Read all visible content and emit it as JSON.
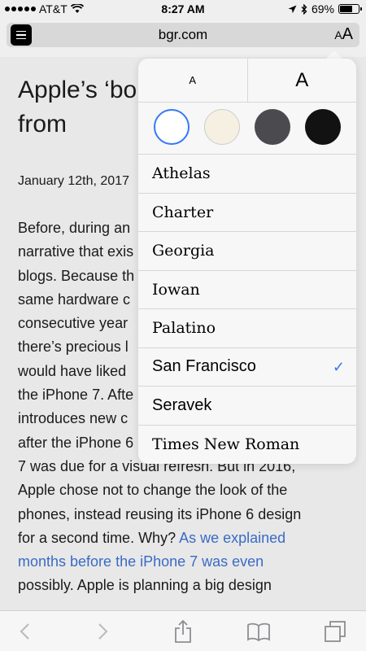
{
  "status_bar": {
    "carrier": "AT&T",
    "time": "8:27 AM",
    "battery": "69%",
    "battery_level": 0.69
  },
  "address_bar": {
    "url": "bgr.com",
    "aa_small": "A",
    "aa_large": "A"
  },
  "article": {
    "title": "Apple’s ‘bo just stole a share from",
    "date": "January 12th, 2017",
    "body_lines": [
      "Before, during an",
      "narrative that exis",
      "blogs. Because th",
      "same hardware c",
      "consecutive year",
      "there’s precious l",
      "would have liked",
      "the iPhone 7. Afte",
      "introduces new c",
      "after the iPhone 6 and iPhone 6s, the iPhone",
      "7 was due for a visual refresh. But in 2016,",
      "Apple chose not to change the look of the",
      "phones, instead reusing its iPhone 6 design",
      "for a second time. Why?"
    ],
    "link_text_1": "As we explained",
    "link_text_2": "months before the iPhone 7 was even",
    "tail_text": "possibly. Apple is planning a big design"
  },
  "popover": {
    "size_small": "A",
    "size_large": "A",
    "themes": [
      {
        "name": "White",
        "color": "#ffffff"
      },
      {
        "name": "Sepia",
        "color": "#f5f0e2"
      },
      {
        "name": "Gray",
        "color": "#4a4a4f"
      },
      {
        "name": "Black",
        "color": "#121212"
      }
    ],
    "fonts": [
      {
        "label": "Athelas",
        "selected": false
      },
      {
        "label": "Charter",
        "selected": false
      },
      {
        "label": "Georgia",
        "selected": false
      },
      {
        "label": "Iowan",
        "selected": false
      },
      {
        "label": "Palatino",
        "selected": false
      },
      {
        "label": "San Francisco",
        "selected": true
      },
      {
        "label": "Seravek",
        "selected": false
      },
      {
        "label": "Times New Roman",
        "selected": false
      }
    ],
    "checkmark": "✓",
    "accent_color": "#3478f6"
  },
  "toolbar": {
    "buttons": [
      "back-icon",
      "forward-icon",
      "share-icon",
      "bookmarks-icon",
      "tabs-icon"
    ]
  }
}
